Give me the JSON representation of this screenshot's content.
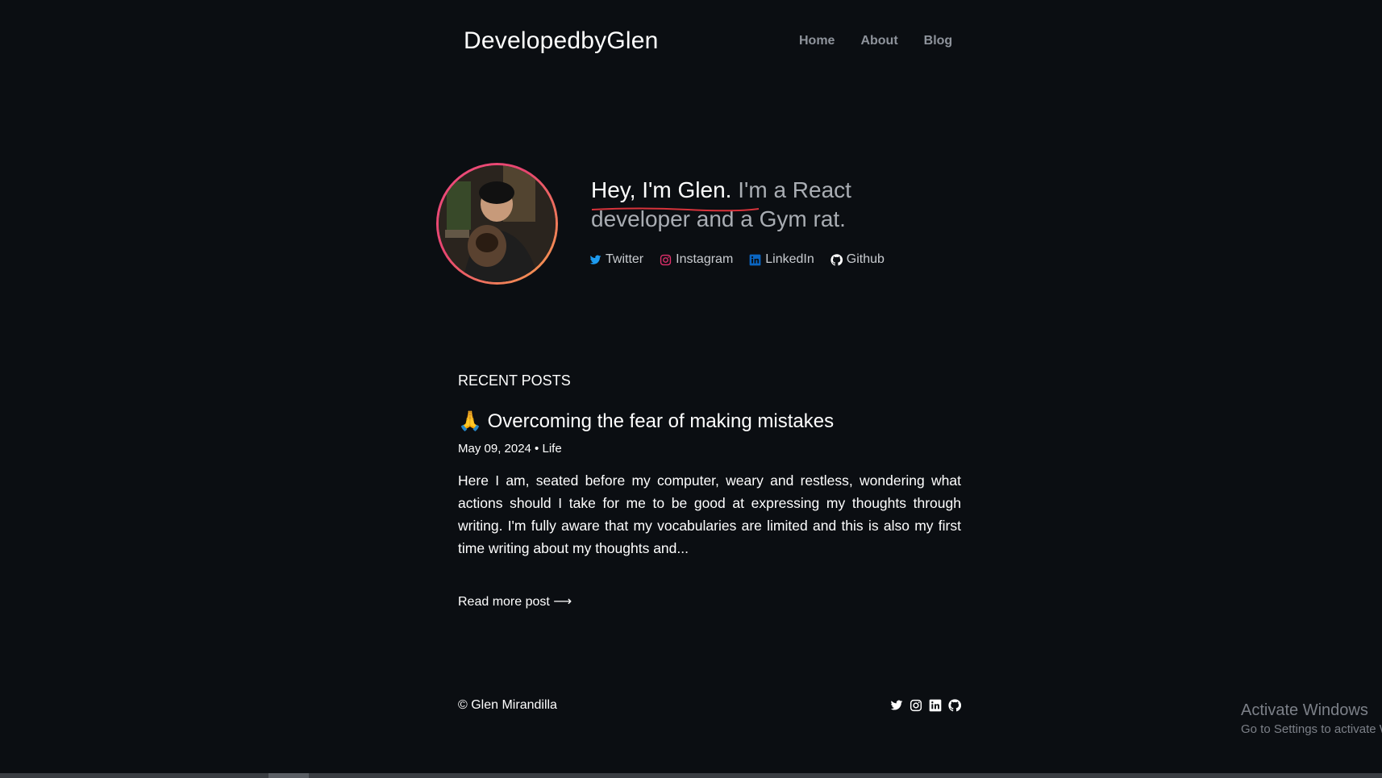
{
  "site": {
    "logo": "DevelopedbyGlen"
  },
  "nav": [
    {
      "label": "Home"
    },
    {
      "label": "About"
    },
    {
      "label": "Blog"
    }
  ],
  "hero": {
    "greeting": "Hey, I'm Glen.",
    "tagline": " I'm a React developer and a Gym rat."
  },
  "socials": [
    {
      "label": "Twitter",
      "icon": "twitter-icon",
      "color": "#1d9bf0"
    },
    {
      "label": "Instagram",
      "icon": "instagram-icon",
      "color": "#e1306c"
    },
    {
      "label": "LinkedIn",
      "icon": "linkedin-icon",
      "color": "#0a66c2"
    },
    {
      "label": "Github",
      "icon": "github-icon",
      "color": "#ffffff"
    }
  ],
  "posts": {
    "section_title": "RECENT POSTS",
    "items": [
      {
        "emoji": "🙏",
        "title": "Overcoming the fear of making mistakes",
        "meta": "May 09, 2024 • Life",
        "excerpt": "Here I am, seated before my computer, weary and restless, wondering what actions should I take for me to be good at expressing my thoughts through writing. I'm fully aware that my vocabularies are limited and this is also my first time writing about my thoughts and...",
        "read_more": "Read more post ⟶"
      }
    ]
  },
  "footer": {
    "copyright": "© Glen Mirandilla"
  },
  "watermark": {
    "title": "Activate Windows",
    "subtitle": "Go to Settings to activate W"
  }
}
